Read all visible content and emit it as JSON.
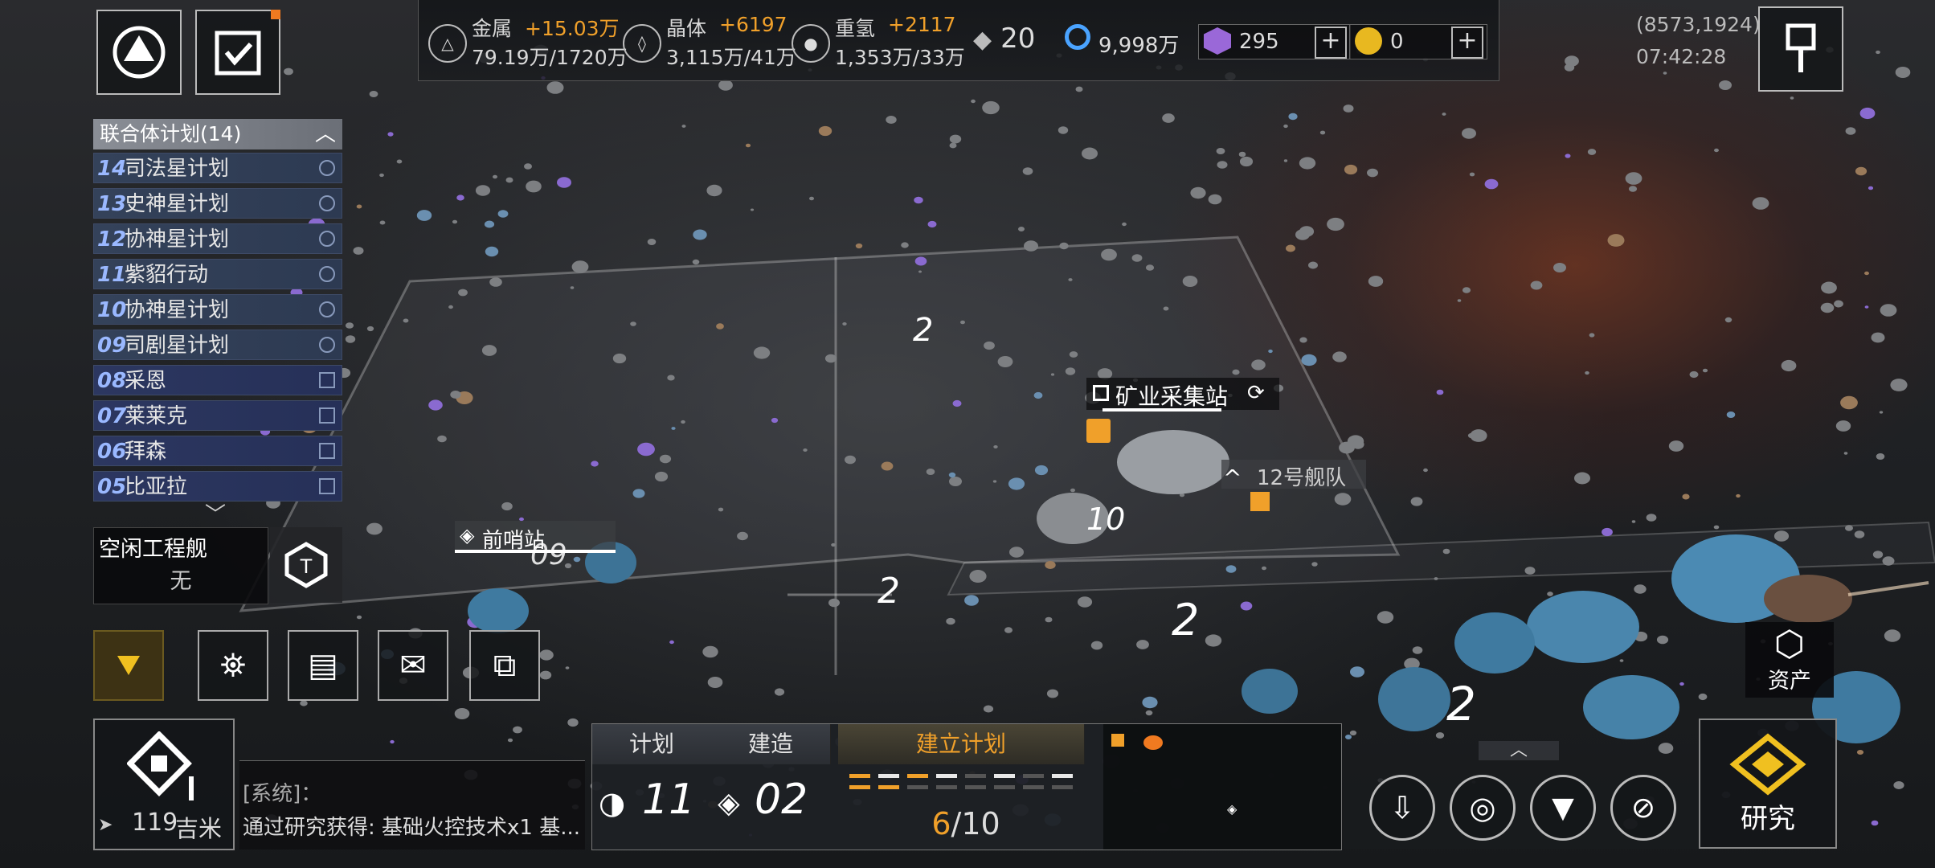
{
  "top_bar": {
    "resources": [
      {
        "name": "金属",
        "increment": "+15.03万",
        "amount": "79.19万/1720万",
        "icon": "metal-triangle-icon"
      },
      {
        "name": "晶体",
        "increment": "+6197",
        "amount": "3,115万/41万",
        "icon": "crystal-icon"
      },
      {
        "name": "重氢",
        "increment": "+2117",
        "amount": "1,353万/33万",
        "icon": "deuterium-icon"
      }
    ],
    "fleet_count": "20",
    "currencies": [
      {
        "value": "9,998万",
        "icon": "credits-icon"
      },
      {
        "value": "295",
        "icon": "premium-p-icon"
      },
      {
        "value": "0",
        "icon": "gold-coin-icon"
      }
    ],
    "coordinates": "(8573,1924)",
    "clock": "07:42:28"
  },
  "plan_list": {
    "header": "联合体计划(14)",
    "items": [
      {
        "num": "14",
        "label": "司法星计划",
        "tag": "round"
      },
      {
        "num": "13",
        "label": "史神星计划",
        "tag": "round"
      },
      {
        "num": "12",
        "label": "协神星计划",
        "tag": "round"
      },
      {
        "num": "11",
        "label": "紫貂行动",
        "tag": "round"
      },
      {
        "num": "10",
        "label": "协神星计划",
        "tag": "round"
      },
      {
        "num": "09",
        "label": "司剧星计划",
        "tag": "round"
      },
      {
        "num": "08",
        "label": "采恩",
        "tag": "square"
      },
      {
        "num": "07",
        "label": "莱莱克",
        "tag": "square"
      },
      {
        "num": "06",
        "label": "拜森",
        "tag": "square"
      },
      {
        "num": "05",
        "label": "比亚拉",
        "tag": "square"
      }
    ]
  },
  "idle_engineer": {
    "label": "空闲工程舰",
    "value": "无"
  },
  "map_labels": {
    "mining_station": "矿业采集站",
    "fleet": "12号舰队",
    "outpost": "前哨站",
    "outpost_level": "09",
    "station_level": "10",
    "asteroid_levels": [
      "2",
      "2",
      "2",
      "2"
    ]
  },
  "distance": {
    "value": "119",
    "unit": "吉米"
  },
  "chat": {
    "channel": "[系统]：",
    "message": "通过研究获得: 基础火控技术x1 基..."
  },
  "bottom_panel": {
    "tabs": {
      "plan": "计划",
      "build": "建造",
      "establish": "建立计划"
    },
    "plan_count": "11",
    "build_count": "02",
    "progress_current": "6",
    "progress_total": "/10",
    "progress_fraction": 0.6
  },
  "assets_button": "资产",
  "research_button": "研究",
  "colors": {
    "accent": "#f0a02a",
    "panel": "#1e2125",
    "list_blue": "#2f3c5c",
    "asteroid_blue": "#4a8fb8"
  }
}
